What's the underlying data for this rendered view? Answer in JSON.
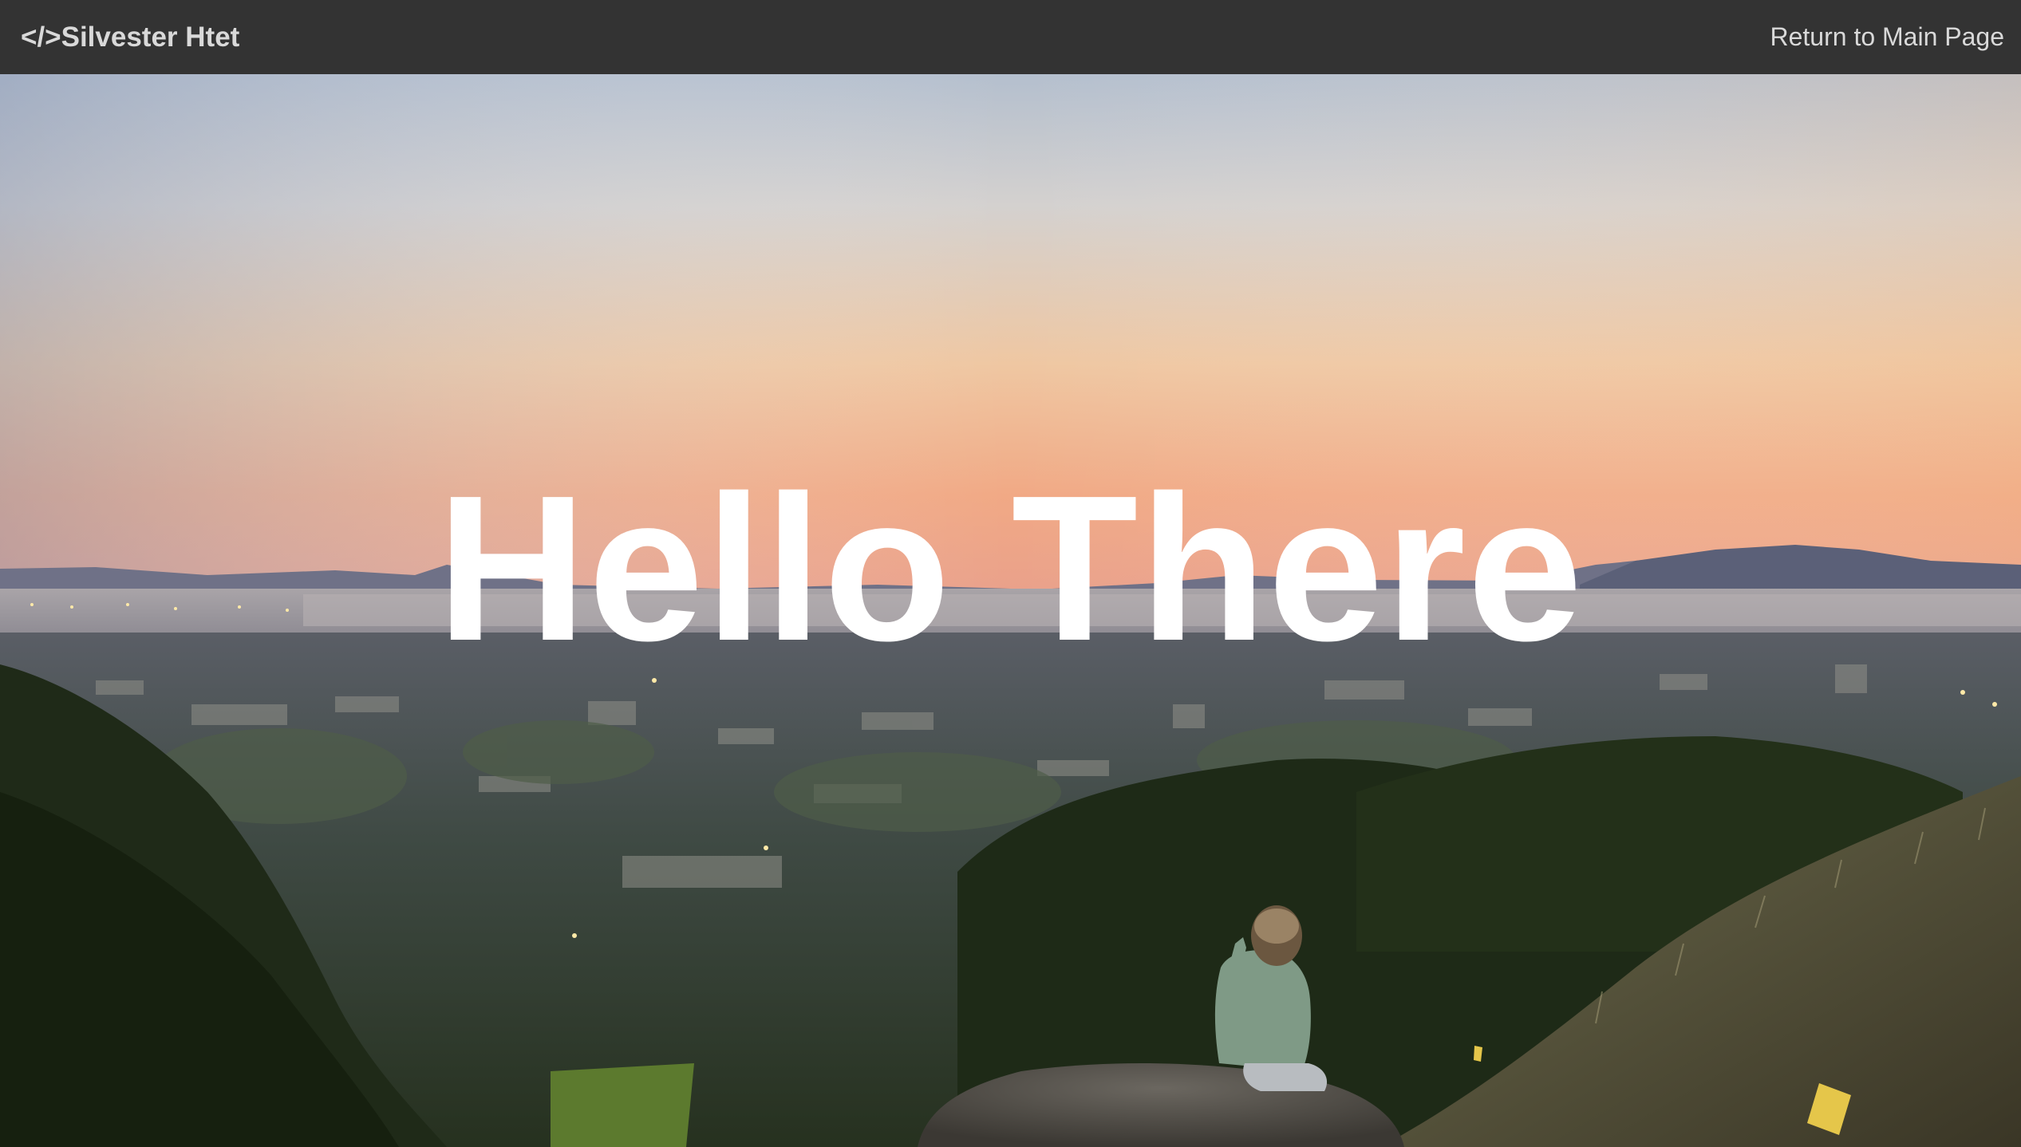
{
  "navbar": {
    "brand": "</>Silvester Htet",
    "return_link": "Return to Main Page"
  },
  "hero": {
    "title": "Hello There",
    "background_image": "sunset-city-hillside-photo"
  },
  "colors": {
    "navbar_bg": "#333333",
    "navbar_text": "#d9d9d9",
    "title": "#ffffff"
  }
}
